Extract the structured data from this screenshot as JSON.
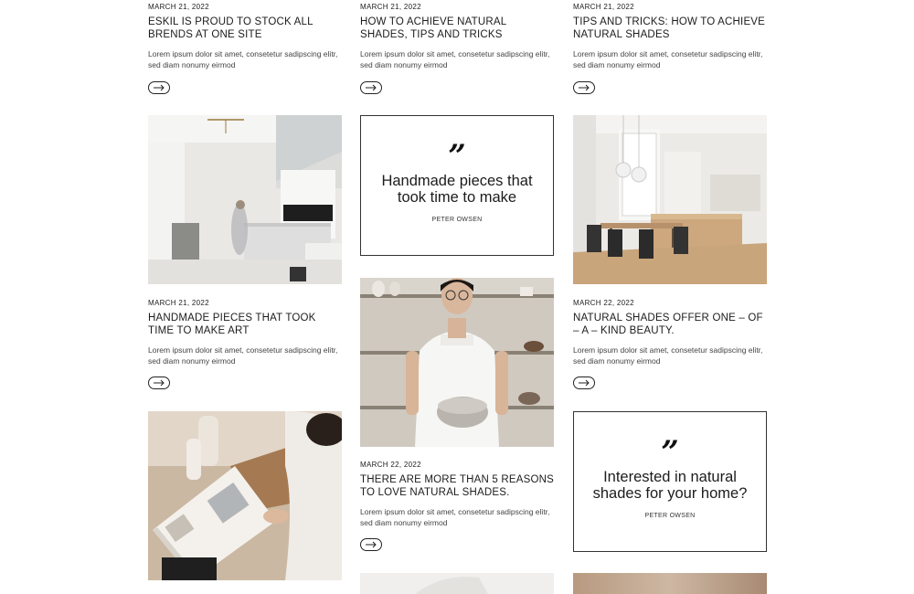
{
  "posts": [
    {
      "date": "MARCH 21, 2022",
      "title": "ESKIL IS PROUD TO STOCK ALL BRENDS AT ONE SITE",
      "excerpt": "Lorem ipsum dolor sit amet, consetetur sadipscing elitr, sed diam nonumy eirmod"
    },
    {
      "date": "MARCH 21, 2022",
      "title": "HOW TO ACHIEVE NATURAL SHADES, TIPS AND TRICKS",
      "excerpt": "Lorem ipsum dolor sit amet, consetetur sadipscing elitr, sed diam nonumy eirmod"
    },
    {
      "date": "MARCH 21, 2022",
      "title": "TIPS AND TRICKS: HOW TO ACHIEVE NATURAL SHADES",
      "excerpt": "Lorem ipsum dolor sit amet, consetetur sadipscing elitr, sed diam nonumy eirmod"
    },
    {
      "date": "MARCH 21, 2022",
      "title": "HANDMADE PIECES THAT TOOK TIME TO MAKE ART",
      "excerpt": "Lorem ipsum dolor sit amet, consetetur sadipscing elitr, sed diam nonumy eirmod"
    },
    {
      "date": "MARCH 22, 2022",
      "title": "NATURAL SHADES OFFER ONE – OF – A – KIND BEAUTY.",
      "excerpt": "Lorem ipsum dolor sit amet, consetetur sadipscing elitr, sed diam nonumy eirmod"
    },
    {
      "date": "MARCH 22, 2022",
      "title": "THERE ARE MORE THAN 5 REASONS TO LOVE NATURAL SHADES.",
      "excerpt": "Lorem ipsum dolor sit amet, consetetur sadipscing elitr, sed diam nonumy eirmod"
    }
  ],
  "quotes": [
    {
      "mark": "”",
      "text": "Handmade pieces that took time to make",
      "author": "PETER OWSEN"
    },
    {
      "mark": "”",
      "text": "Interested in natural shades for your home?",
      "author": "PETER OWSEN"
    }
  ],
  "icons": {
    "read_more": "arrow-right-icon"
  },
  "colors": {
    "text": "#222222",
    "border": "#333333",
    "background": "#ffffff"
  }
}
